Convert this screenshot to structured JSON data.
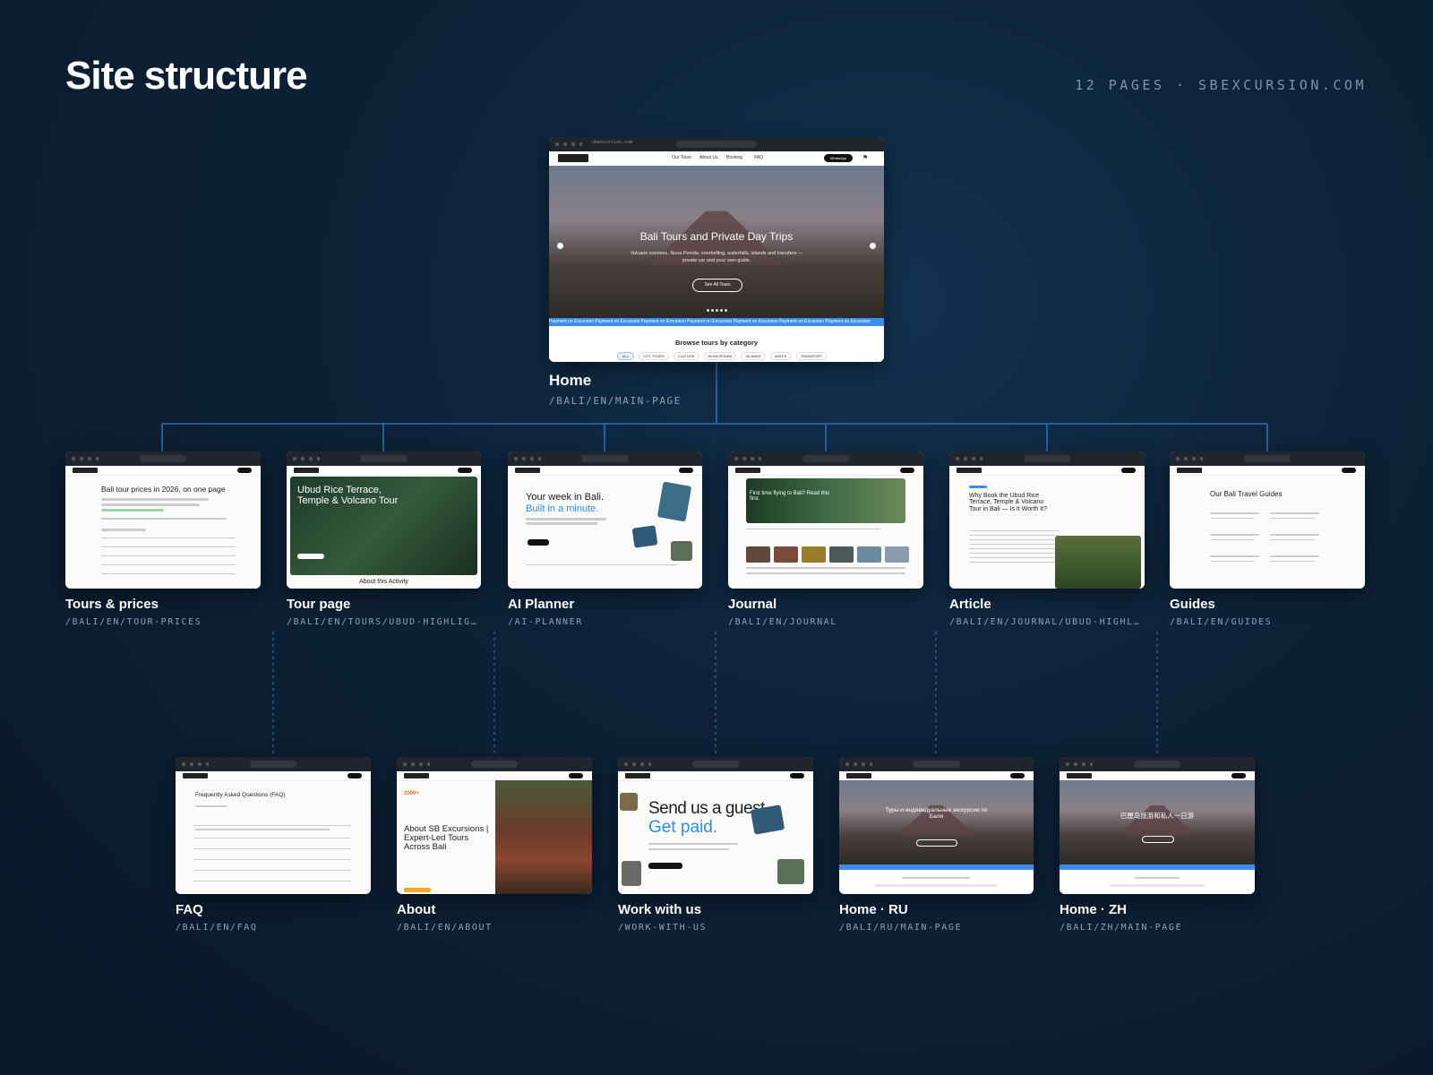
{
  "header": {
    "title": "Site structure",
    "meta": "12 PAGES · SBEXCURSION.COM"
  },
  "home": {
    "name": "Home",
    "path": "/BALI/EN/MAIN-PAGE",
    "url": "sbexcursion.com",
    "nav": [
      "Our Tours",
      "About Us",
      "Booking",
      "FAQ"
    ],
    "cta": "WhatsApp",
    "hero_title": "Bali Tours and Private Day Trips",
    "hero_sub": "Volcano sunrises, Nusa Penida, snorkelling, waterfalls, islands and transfers — private car and your own guide.",
    "hero_btn": "See All Tours",
    "strip_text": "Payment on Excursion   Payment on Excursion   Payment on Excursion   Payment on Excursion   Payment on Excursion   Payment on Excursion   Payment on Excursion",
    "browse": "Browse tours by category",
    "chips": [
      "ALL",
      "CITY TOURS",
      "CULTURE",
      "NUSA PENIDA",
      "ISLANDS",
      "WATER",
      "TRANSPORT"
    ]
  },
  "row2": [
    {
      "name": "Tours & prices",
      "path": "/BALI/EN/TOUR-PRICES",
      "headline": "Bali tour prices in 2026, on one page"
    },
    {
      "name": "Tour page",
      "path": "/BALI/EN/TOURS/UBUD-HIGHLIGHTS-RICE-TERRACE",
      "headline": "Ubud Rice Terrace, Temple & Volcano Tour",
      "sub": "About this Activity"
    },
    {
      "name": "AI Planner",
      "path": "/AI-PLANNER",
      "headline": "Your week in Bali.",
      "headline2": "Built in a minute."
    },
    {
      "name": "Journal",
      "path": "/BALI/EN/JOURNAL",
      "headline": "First time flying to Bali? Read this first."
    },
    {
      "name": "Article",
      "path": "/BALI/EN/JOURNAL/UBUD-HIGHLIGHTS-WORTH-IT",
      "headline": "Why Book the Ubud Rice Terrace, Temple & Volcano Tour in Bali — Is It Worth It?"
    },
    {
      "name": "Guides",
      "path": "/BALI/EN/GUIDES",
      "headline": "Our Bali Travel Guides"
    }
  ],
  "row3": [
    {
      "name": "FAQ",
      "path": "/BALI/EN/FAQ",
      "headline": "Frequently Asked Questions (FAQ)"
    },
    {
      "name": "About",
      "path": "/BALI/EN/ABOUT",
      "headline": "About SB Excursions | Expert-Led Tours Across Bali",
      "badge": "2000+"
    },
    {
      "name": "Work with us",
      "path": "/WORK-WITH-US",
      "headline": "Send us a guest.",
      "headline2": "Get paid."
    },
    {
      "name": "Home · RU",
      "path": "/BALI/RU/MAIN-PAGE",
      "headline": "Туры и индивидуальные экскурсии по Бали"
    },
    {
      "name": "Home · ZH",
      "path": "/BALI/ZH/MAIN-PAGE",
      "headline": "巴厘岛旅游和私人一日游"
    }
  ],
  "colors": {
    "bg": "#0d2238",
    "connector": "#2f6db3",
    "accent_blue": "#3b8df0"
  }
}
